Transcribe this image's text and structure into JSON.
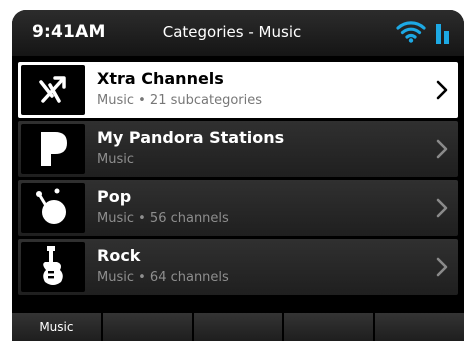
{
  "status_bar": {
    "time": "9:41AM",
    "title": "Categories - Music",
    "icons": [
      "wifi-icon",
      "signal-bars-icon"
    ],
    "accent_color": "#1da9e4"
  },
  "list": {
    "items": [
      {
        "title": "Xtra Channels",
        "subtitle": "Music • 21 subcategories",
        "icon": "shuffle-icon",
        "selected": true
      },
      {
        "title": "My Pandora Stations",
        "subtitle": "Music",
        "icon": "pandora-logo-icon",
        "selected": false
      },
      {
        "title": "Pop",
        "subtitle": "Music • 56 channels",
        "icon": "pop-icon",
        "selected": false
      },
      {
        "title": "Rock",
        "subtitle": "Music • 64 channels",
        "icon": "guitar-icon",
        "selected": false
      }
    ]
  },
  "tabbar": {
    "tabs": [
      "Music",
      "",
      "",
      "",
      ""
    ]
  }
}
